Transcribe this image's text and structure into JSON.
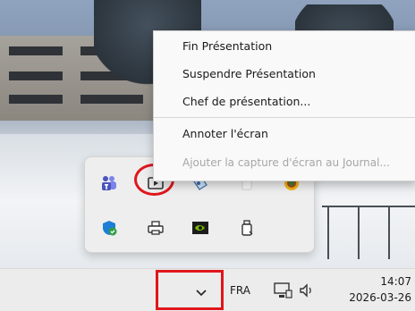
{
  "context_menu": {
    "items": [
      {
        "label": "Fin Présentation",
        "enabled": true
      },
      {
        "label": "Suspendre Présentation",
        "enabled": true
      },
      {
        "label": "Chef de présentation...",
        "enabled": true
      },
      {
        "label": "Annoter l'écran",
        "enabled": true
      },
      {
        "label": "Ajouter la capture d'écran au Journal...",
        "enabled": false
      }
    ]
  },
  "tray_overflow": {
    "row1": [
      "teams-icon",
      "presentation-icon",
      "paint-icon",
      "blank-icon",
      "sketch-icon"
    ],
    "row2": [
      "defender-icon",
      "printer-icon",
      "nvidia-icon",
      "usb-drive-icon"
    ]
  },
  "taskbar": {
    "language": "FRA",
    "time": "14:07",
    "date": "2026-03-26"
  },
  "highlight_color": "#e0161b"
}
